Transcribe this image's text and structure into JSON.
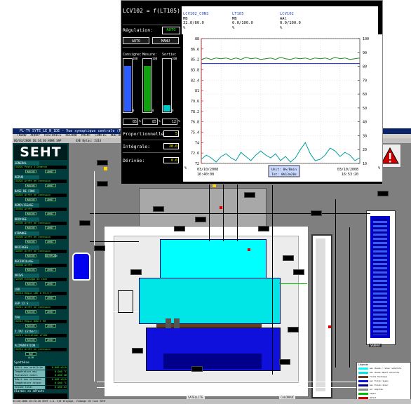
{
  "scada": {
    "titlebar": "PL-TV  SYTE_LE_N_1DE  -  Vue synoptique centrale (Format 1600x1200)",
    "menubar": [
      "TREND",
      "ARRAY",
      "HISTORICS",
      "RECORD",
      "PRINT",
      "CONFIG",
      "ADD-ON"
    ],
    "toolbar_left": "06/03/2008  16:34:30  HEHE SAP",
    "toolbar_mid": "SXE Bylas: 2414",
    "logo": "SEHT",
    "groups": [
      {
        "title": "GENERAL",
        "info": "SXE01  Poste 1 Général",
        "btn1": "MARCHE",
        "btn2": "ARRET"
      },
      {
        "title": "REPUR",
        "info": "SXE02  Arrêt en pression",
        "btn1": "MARCHE",
        "btn2": "ARRET"
      },
      {
        "title": "BASE DE FONC",
        "info": "SXE03  Arrêt en pression",
        "btn1": "MARCHE",
        "btn2": "ARRET"
      },
      {
        "title": "REMPLISSAGE",
        "info": "SXE04  Arrêt",
        "btn1": "MARCHE",
        "btn2": "ARRET"
      },
      {
        "title": "BROYAGE",
        "info": "SXE05  Arrêt en pression",
        "btn1": "MARCHE",
        "btn2": "ARRET"
      },
      {
        "title": "VIDANGE",
        "info": "SXE06  Arrêt en pression",
        "btn1": "MARCHE",
        "btn2": "ARRET"
      },
      {
        "title": "BRICAGES",
        "info": "SXE07  Arrêt en pression",
        "btn1": "MARCHE",
        "btn2": "DEVERSAGE"
      },
      {
        "title": "RECIRCULAGE",
        "info": "SXE08  Arrêt",
        "btn1": "MARCHE",
        "btn2": "ARRET"
      },
      {
        "title": "DRIVE",
        "info": "SXE09  Échange de chal",
        "btn1": "MARCHE",
        "btn2": "ARRET"
      },
      {
        "title": "LBD",
        "info": "SXE10  Régul LBD à 95.0 F",
        "btn1": "MARCHE",
        "btn2": "ARRET"
      },
      {
        "title": "SEP 12 S",
        "info": "SXE11  Arrêt en pression",
        "btn1": "MARCHE",
        "btn2": "ARRET"
      },
      {
        "title": "TPA",
        "info": "SXE12  Régul Débit 90",
        "btn1": "MARCHE",
        "btn2": "ARRET"
      },
      {
        "title": "T.TAT (Ether)",
        "info": "SXE13  Variation LT101",
        "btn1": "MARCHE",
        "btn2": "ARRET"
      },
      {
        "title": "ALIMENTATION",
        "info": "SXE14  Arrêt en pression",
        "btn1": "MAR ALIM",
        "btn2": ""
      }
    ],
    "synthese_title": "Synthèse",
    "synthese": [
      {
        "k": "Débit eau satellite",
        "v": "0.000 m3/h"
      },
      {
        "k": "Température eau",
        "v": "0.000 °C"
      },
      {
        "k": "Puissance cumul.",
        "v": "0.000 kW"
      },
      {
        "k": "Débit eau calodouc",
        "v": "0.000 m3/h"
      },
      {
        "k": "Température retour",
        "v": "0.000 °C"
      },
      {
        "k": "Volume total",
        "v": "0.000 m3"
      }
    ],
    "alarms_title": "Alarmes en défauts",
    "labels": {
      "satellite": "SATELLITE",
      "calodouc": "CALODOUC",
      "sarrat": "SARRAT"
    },
    "legend": {
      "title": "Légende",
      "rows": [
        {
          "color": "#00ffff",
          "text": "eau chaude / retour satellite"
        },
        {
          "color": "#00e5e5",
          "text": "eau chaude départ satellite"
        },
        {
          "color": "#6b3a1f",
          "text": "fluide thermique"
        },
        {
          "color": "#1010dd",
          "text": "eau froide réseau"
        },
        {
          "color": "#00008b",
          "text": "eau froide retour"
        },
        {
          "color": "#888888",
          "text": "air comprimé"
        },
        {
          "color": "#00c000",
          "text": "vapeur"
        },
        {
          "color": "#d00000",
          "text": "défaut"
        }
      ]
    },
    "status": "03:10:2008  16:53:20  SEHT  C.A. Sté Broyage, Vidange de Cuve SEHT"
  },
  "trend": {
    "title": "LCV102 = f(LT105)",
    "regulation_label": "Régulation:",
    "regulation_value": "AUTO",
    "btn_auto": "AUTO",
    "btn_manu": "MANU",
    "col_consigne": "Consigne:",
    "col_mesure": "Mesure:",
    "col_sortie": "Sortie:",
    "bar_top": "100",
    "bar_zero": "0",
    "consigne": {
      "value": "85",
      "unit": "%",
      "pct": 85,
      "color": "#2a5cff"
    },
    "mesure": {
      "value": "85",
      "unit": "%",
      "pct": 85,
      "color": "#10a010"
    },
    "sortie": {
      "value": "12",
      "unit": "%",
      "pct": 12,
      "color": "#00c8c8"
    },
    "prop_label": "Proportionnelle:",
    "prop_value": "5",
    "integ_label": "Intégrale:",
    "integ_value": "20.0",
    "deriv_label": "Dérivée:",
    "deriv_value": "0.0",
    "columns": [
      {
        "name": "LCV102_CONS",
        "code": "MB",
        "val": "32.0/80.0",
        "unit": "%"
      },
      {
        "name": "LT105",
        "code": "MB",
        "val": "0.0/100.0",
        "unit": "%"
      },
      {
        "name": "LCV102",
        "code": "AAl",
        "val": "0.0/100.0",
        "unit": "%"
      }
    ]
  },
  "chart_data": {
    "type": "line",
    "ylim_left": [
      72,
      88
    ],
    "yticks_left": [
      "88",
      "86.6",
      "85.2",
      "83.8",
      "82.4",
      "81",
      "79.6",
      "78.2",
      "76.8",
      "75.4",
      "74",
      "72.6",
      "72"
    ],
    "ylim_right": [
      10,
      100
    ],
    "yticks_right": [
      "100",
      "90",
      "80",
      "70",
      "60",
      "50",
      "40",
      "30",
      "20",
      "10"
    ],
    "left_unit": "%",
    "right_unit": "%",
    "x_start": "03/10/2008\n16:40:00",
    "x_end": "03/10/2008\n16:53:20",
    "x_center": "Unit: 0%/Bmin\nTot: 0h13m20s",
    "series": [
      {
        "name": "LT105",
        "color": "#1a8a1a",
        "axis": "right",
        "values": [
          85,
          86,
          85,
          86,
          85.5,
          86,
          85,
          86,
          85,
          86.5,
          85.5,
          86,
          85,
          85.5,
          86,
          85,
          86.5,
          85.5,
          85,
          86,
          85.5,
          86,
          85,
          86,
          85.5,
          86,
          85,
          86.5,
          85.5,
          86,
          85,
          85.5,
          86
        ]
      },
      {
        "name": "LCV102_CONS",
        "color": "#2222cc",
        "axis": "right",
        "values": [
          82,
          82,
          82,
          82,
          82,
          82,
          82,
          82,
          82,
          82,
          82,
          82,
          82,
          82,
          82,
          82,
          82,
          82,
          82,
          82,
          82,
          82,
          82,
          82,
          82,
          82,
          82,
          82,
          82,
          82,
          82,
          82,
          82
        ]
      },
      {
        "name": "LCV102",
        "color": "#00a0a0",
        "axis": "right",
        "values": [
          13,
          16,
          14,
          11,
          15,
          17,
          14,
          12,
          18,
          15,
          12,
          16,
          19,
          16,
          14,
          17,
          12,
          15,
          11,
          14,
          20,
          25,
          17,
          12,
          13,
          16,
          21,
          19,
          15,
          18,
          16,
          12,
          14
        ]
      }
    ]
  }
}
